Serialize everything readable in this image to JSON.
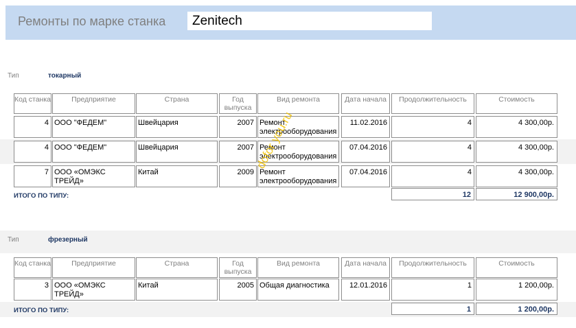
{
  "report": {
    "title": "Ремонты по марке станка",
    "brand": "Zenitech"
  },
  "columns": [
    "Код станка",
    "Предприятие",
    "Страна",
    "Год выпуска",
    "Вид ремонта",
    "Дата начала",
    "Продолжительность",
    "Стоимость"
  ],
  "groups": [
    {
      "type_label": "Тип",
      "type_value": "токарный",
      "rows": [
        {
          "code": "4",
          "company": "ООО \"ФЕДЕМ\"",
          "country": "Швейцария",
          "year": "2007",
          "repair": "Ремонт электрооборудования",
          "date": "11.02.2016",
          "duration": "4",
          "cost": "4 300,00р."
        },
        {
          "code": "4",
          "company": "ООО \"ФЕДЕМ\"",
          "country": "Швейцария",
          "year": "2007",
          "repair": "Ремонт электрооборудования",
          "date": "07.04.2016",
          "duration": "4",
          "cost": "4 300,00р."
        },
        {
          "code": "7",
          "company": "ООО «ОМЭКС ТРЕЙД»",
          "country": "Китай",
          "year": "2009",
          "repair": "Ремонт электрооборудования",
          "date": "07.04.2016",
          "duration": "4",
          "cost": "4 300,00р."
        }
      ],
      "total_label": "ИТОГО ПО ТИПУ:",
      "total_duration": "12",
      "total_cost": "12 900,00р."
    },
    {
      "type_label": "Тип",
      "type_value": "фрезерный",
      "rows": [
        {
          "code": "3",
          "company": "ООО «ОМЭКС ТРЕЙД»",
          "country": "Китай",
          "year": "2005",
          "repair": "Общая диагностика",
          "date": "12.01.2016",
          "duration": "1",
          "cost": "1 200,00р."
        }
      ],
      "total_label": "ИТОГО ПО ТИПУ:",
      "total_duration": "1",
      "total_cost": "1 200,00р."
    }
  ],
  "watermark": "dofor you.ru",
  "colors": {
    "header_bg": "#c5d9f1",
    "band_bg": "#f2f2f2",
    "accent_text": "#1f3864",
    "watermark": "#f0c000"
  }
}
